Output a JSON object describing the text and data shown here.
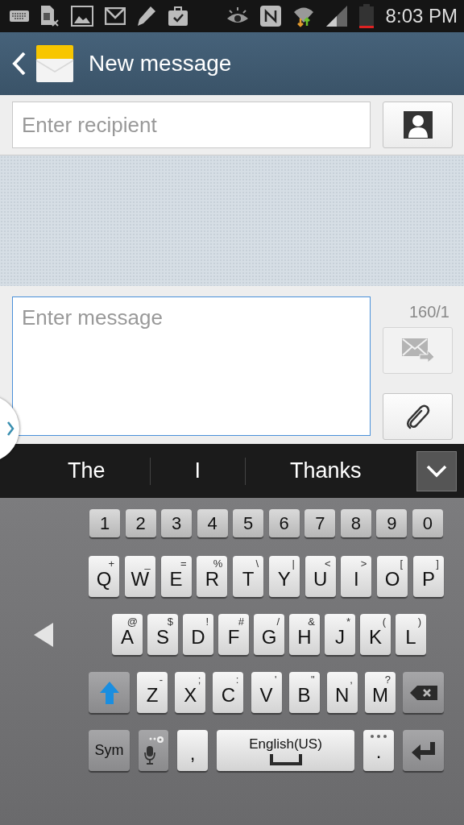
{
  "status_bar": {
    "time": "8:03 PM"
  },
  "header": {
    "title": "New message"
  },
  "recipient": {
    "placeholder": "Enter recipient"
  },
  "compose": {
    "placeholder": "Enter message",
    "counter": "160/1",
    "send_disabled": true
  },
  "suggestions": [
    "The",
    "I",
    "Thanks"
  ],
  "keyboard": {
    "number_row": [
      {
        "kind": "num",
        "label": "1"
      },
      {
        "kind": "num",
        "label": "2"
      },
      {
        "kind": "num",
        "label": "3"
      },
      {
        "kind": "num",
        "label": "4"
      },
      {
        "kind": "num",
        "label": "5"
      },
      {
        "kind": "num",
        "label": "6"
      },
      {
        "kind": "num",
        "label": "7"
      },
      {
        "kind": "num",
        "label": "8"
      },
      {
        "kind": "num",
        "label": "9"
      },
      {
        "kind": "num",
        "label": "0"
      }
    ],
    "top_row": [
      {
        "kind": "char",
        "label": "Q",
        "alt": "+"
      },
      {
        "kind": "char",
        "label": "W",
        "alt": "_"
      },
      {
        "kind": "char",
        "label": "E",
        "alt": "="
      },
      {
        "kind": "char",
        "label": "R",
        "alt": "%"
      },
      {
        "kind": "char",
        "label": "T",
        "alt": "\\"
      },
      {
        "kind": "char",
        "label": "Y",
        "alt": "|"
      },
      {
        "kind": "char",
        "label": "U",
        "alt": "<"
      },
      {
        "kind": "char",
        "label": "I",
        "alt": ">"
      },
      {
        "kind": "char",
        "label": "O",
        "alt": "["
      },
      {
        "kind": "char",
        "label": "P",
        "alt": "]"
      }
    ],
    "home_row": [
      {
        "kind": "arrow"
      },
      {
        "kind": "char",
        "label": "A",
        "alt": "@"
      },
      {
        "kind": "char",
        "label": "S",
        "alt": "$"
      },
      {
        "kind": "char",
        "label": "D",
        "alt": "!"
      },
      {
        "kind": "char",
        "label": "F",
        "alt": "#"
      },
      {
        "kind": "char",
        "label": "G",
        "alt": "/"
      },
      {
        "kind": "char",
        "label": "H",
        "alt": "&"
      },
      {
        "kind": "char",
        "label": "J",
        "alt": "*"
      },
      {
        "kind": "char",
        "label": "K",
        "alt": "("
      },
      {
        "kind": "char",
        "label": "L",
        "alt": ")"
      }
    ],
    "bottom_row": [
      {
        "kind": "shift"
      },
      {
        "kind": "char",
        "label": "Z",
        "alt": "-"
      },
      {
        "kind": "char",
        "label": "X",
        "alt": ";"
      },
      {
        "kind": "char",
        "label": "C",
        "alt": ":"
      },
      {
        "kind": "char",
        "label": "V",
        "alt": "'"
      },
      {
        "kind": "char",
        "label": "B",
        "alt": "\""
      },
      {
        "kind": "char",
        "label": "N",
        "alt": ","
      },
      {
        "kind": "char",
        "label": "M",
        "alt": "?"
      },
      {
        "kind": "backspace"
      }
    ],
    "function_row": [
      {
        "kind": "sym",
        "label": "Sym"
      },
      {
        "kind": "mic"
      },
      {
        "kind": "char",
        "label": ","
      },
      {
        "kind": "space",
        "label": "English(US)"
      },
      {
        "kind": "period",
        "label": "."
      },
      {
        "kind": "enter"
      }
    ]
  }
}
